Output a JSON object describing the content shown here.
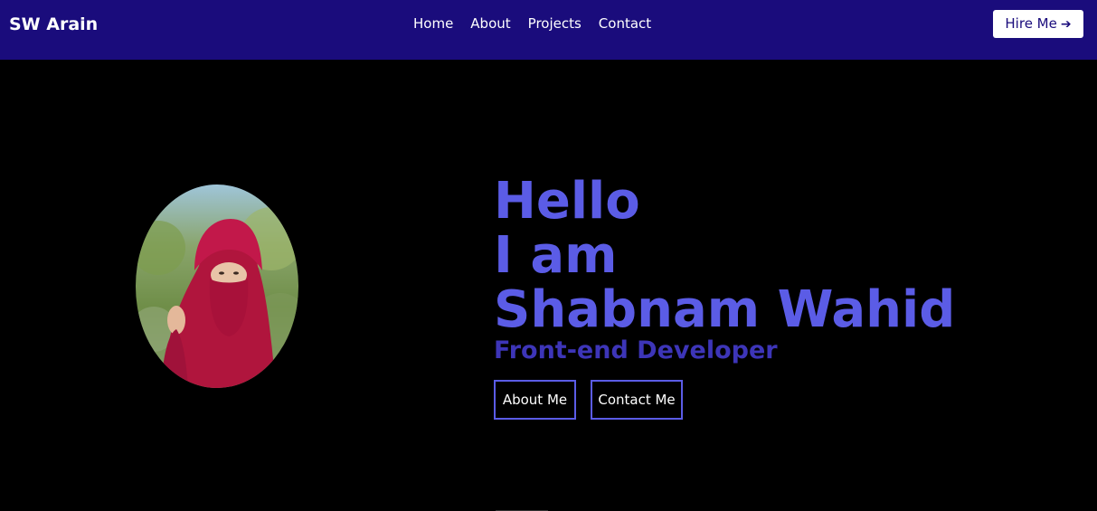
{
  "navbar": {
    "brand": "SW Arain",
    "links": [
      "Home",
      "About",
      "Projects",
      "Contact"
    ],
    "hire_label": "Hire Me",
    "hire_icon": "arrow-right-icon"
  },
  "hero": {
    "line1": "Hello",
    "line2": "I am",
    "line3": "Shabnam Wahid",
    "subtitle": "Front-end Developer",
    "buttons": {
      "about": "About Me",
      "contact": "Contact Me"
    }
  },
  "colors": {
    "navbar_bg": "#1a0c7c",
    "accent": "#5b5ce6",
    "subtitle": "#3d35b8",
    "background": "#000000"
  }
}
